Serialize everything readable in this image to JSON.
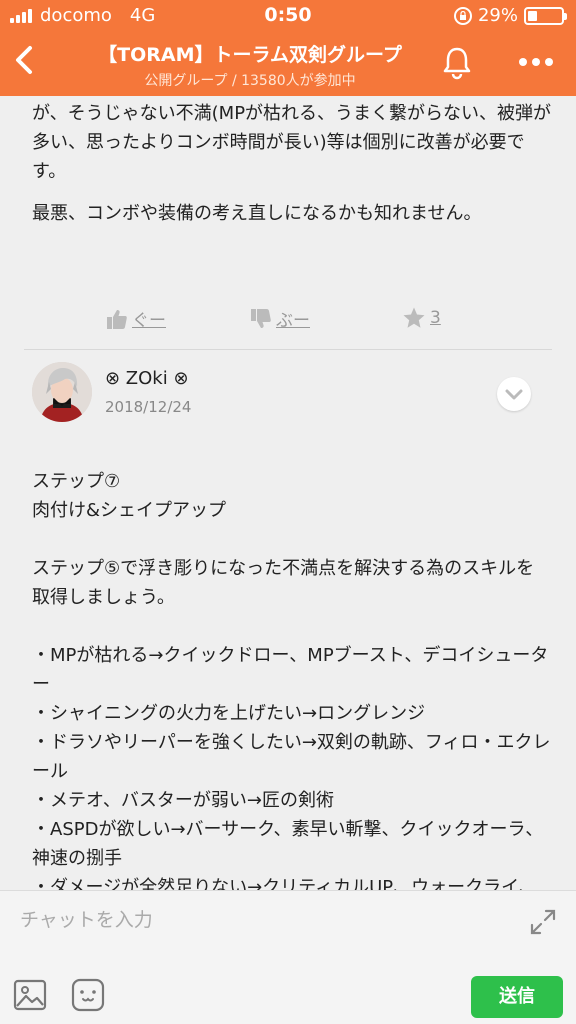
{
  "status_bar": {
    "carrier": "docomo",
    "network": "4G",
    "time": "0:50",
    "battery": "29%",
    "battery_level": 0.29
  },
  "header": {
    "title": "【TORAM】トーラム双剣グループ",
    "subtitle": "公開グループ / 13580人が参加中"
  },
  "post1": {
    "text_tail": "が、そうじゃない不満(MPが枯れる、うまく繋がらない、被弾が多い、思ったよりコンボ時間が長い)等は個別に改善が必要です。",
    "text_last": "最悪、コンボや装備の考え直しになるかも知れません。",
    "reactions": {
      "good_label": "ぐー",
      "bad_label": "ぶー",
      "star_count": "3"
    }
  },
  "post2": {
    "author": "⊗ ZOki ⊗",
    "date": "2018/12/24",
    "body": "ステップ⑦\n肉付け&シェイプアップ\n\nステップ⑤で浮き彫りになった不満点を解決する為のスキルを取得しましょう。\n\n・MPが枯れる→クイックドロー、MPブースト、デコイシューター\n・シャイニングの火力を上げたい→ロングレンジ\n・ドラソやリーパーを強くしたい→双剣の軌跡、フィロ・エクレール\n・メテオ、バスターが弱い→匠の剣術\n・ASPDが欲しい→バーサーク、素早い斬撃、クイックオーラ、神速の捌手\n・ダメージが全然足りない→クリティカルUP、ウォークライ、攻撃力UP、更なる威力、クリスタ装着・交換\n・クリ率が足りない→クリティカルUP、装備の変更"
  },
  "input_bar": {
    "placeholder": "チャットを入力",
    "send_label": "送信"
  },
  "colors": {
    "header": "#f5773a",
    "send": "#2ec04b"
  }
}
